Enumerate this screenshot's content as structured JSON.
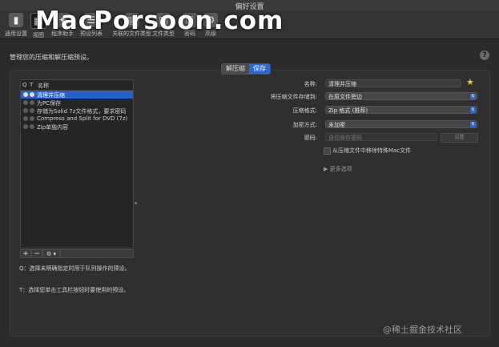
{
  "window": {
    "title": "偏好设置"
  },
  "watermark_top": "MacPorsoon.com",
  "toolbar": {
    "items": [
      {
        "label": "通用设置",
        "icon": "switch-icon"
      },
      {
        "label": "视图",
        "icon": "view-icon"
      },
      {
        "label": "程序助手",
        "icon": "wand-icon"
      },
      {
        "label": "预设列表",
        "icon": "list-icon"
      },
      {
        "label": "关联的文件类型",
        "icon": "file-icon"
      },
      {
        "label": "文件类型",
        "icon": "file-type-icon"
      },
      {
        "label": "密码",
        "icon": "lock-icon"
      },
      {
        "label": "高级",
        "icon": "gear-icon"
      }
    ]
  },
  "header": {
    "text": "管理您的压缩和解压缩预设。",
    "help": "?"
  },
  "segments": [
    {
      "label": "解压缩",
      "active": false
    },
    {
      "label": "保存",
      "active": true
    }
  ],
  "presets": {
    "columns": {
      "q": "Q",
      "t": "T",
      "name": "名称"
    },
    "rows": [
      {
        "name": "清理并压缩",
        "selected": true
      },
      {
        "name": "为PC保存",
        "selected": false
      },
      {
        "name": "存储为Solid 7z文件格式，要求密码",
        "selected": false
      },
      {
        "name": "Compress and Split for DVD (7z)",
        "selected": false
      },
      {
        "name": "Zip单独内容",
        "selected": false
      }
    ],
    "buttons": {
      "add": "+",
      "remove": "−",
      "action": "⚙ ▾"
    }
  },
  "notes": {
    "q": "Q：选择未明确指定时用于队列操作的预设。",
    "t": "T：选择您单击工具栏按钮时要使用的预设。"
  },
  "form": {
    "name_label": "名称:",
    "name_value": "清理并压缩",
    "save_to_label": "将压缩文件存储到:",
    "save_to_value": "在原文件旁边",
    "format_label": "压缩格式:",
    "format_value": "Zip 格式 (推荐)",
    "encrypt_label": "加密方式:",
    "encrypt_value": "未加密",
    "password_label": "密码:",
    "password_placeholder": "自动保存密码",
    "set_button": "设置",
    "remove_mac_files": "从压缩文件中移除特殊Mac文件",
    "more_options": "▶ 更多选项"
  },
  "watermark_bottom": "@稀土掘金技术社区",
  "colors": {
    "accent": "#2a6ad6",
    "star": "#f4c430"
  }
}
